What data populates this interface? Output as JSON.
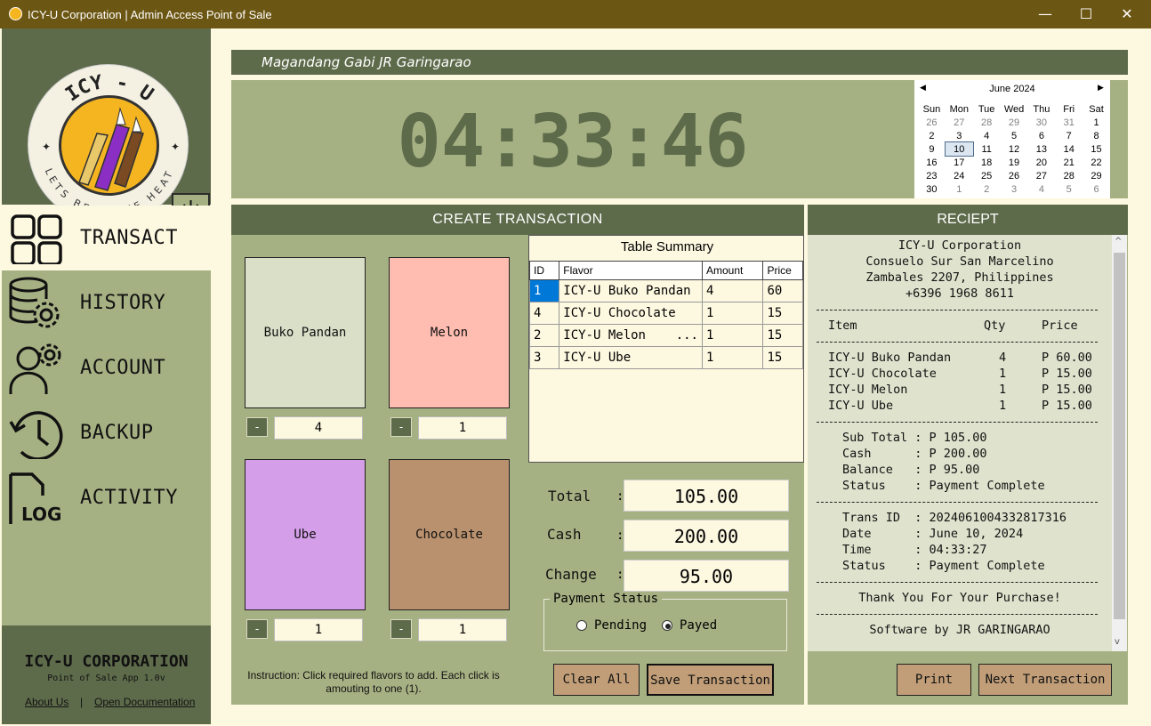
{
  "window": {
    "title": "ICY-U Corporation | Admin Access Point of Sale"
  },
  "logo": {
    "top_text": "ICY - U",
    "tagline": "LETS BEAT THE HEAT"
  },
  "nav": {
    "items": [
      {
        "label": "TRANSACT",
        "icon": "grid-icon"
      },
      {
        "label": "HISTORY",
        "icon": "database-gear-icon"
      },
      {
        "label": "ACCOUNT",
        "icon": "user-gear-icon"
      },
      {
        "label": "BACKUP",
        "icon": "history-clock-icon"
      },
      {
        "label": "ACTIVITY",
        "icon": "log-file-icon"
      }
    ]
  },
  "footer": {
    "company": "ICY-U CORPORATION",
    "version": "Point of Sale App 1.0v",
    "about": "About Us",
    "separator": "|",
    "docs": "Open Documentation"
  },
  "greeting": "Magandang Gabi JR Garingarao",
  "clock": "04:33:46",
  "calendar": {
    "month": "June 2024",
    "days": [
      "Sun",
      "Mon",
      "Tue",
      "Wed",
      "Thu",
      "Fri",
      "Sat"
    ],
    "weeks": [
      [
        "26",
        "27",
        "28",
        "29",
        "30",
        "31",
        "1"
      ],
      [
        "2",
        "3",
        "4",
        "5",
        "6",
        "7",
        "8"
      ],
      [
        "9",
        "10",
        "11",
        "12",
        "13",
        "14",
        "15"
      ],
      [
        "16",
        "17",
        "18",
        "19",
        "20",
        "21",
        "22"
      ],
      [
        "23",
        "24",
        "25",
        "26",
        "27",
        "28",
        "29"
      ],
      [
        "30",
        "1",
        "2",
        "3",
        "4",
        "5",
        "6"
      ]
    ],
    "selected": "10"
  },
  "create": {
    "title": "CREATE TRANSACTION",
    "flavors": [
      {
        "name": "Buko Pandan",
        "qty": "4",
        "color": "#dadfc8"
      },
      {
        "name": "Melon",
        "qty": "1",
        "color": "#ffbcb1"
      },
      {
        "name": "Ube",
        "qty": "1",
        "color": "#d59ee8"
      },
      {
        "name": "Chocolate",
        "qty": "1",
        "color": "#b9916e"
      }
    ],
    "minus_label": "-",
    "instruction": "Instruction: Click required flavors to add. Each click is amouting to one (1)."
  },
  "summary": {
    "title": "Table Summary",
    "columns": [
      "ID",
      "Flavor",
      "Amount",
      "Price"
    ],
    "rows": [
      [
        "1",
        "ICY-U Buko Pandan",
        "4",
        "60"
      ],
      [
        "4",
        "ICY-U Chocolate",
        "1",
        "15"
      ],
      [
        "2",
        "ICY-U Melon    ...",
        "1",
        "15"
      ],
      [
        "3",
        "ICY-U Ube",
        "1",
        "15"
      ]
    ]
  },
  "totals": {
    "total_label": "Total",
    "total": "105.00",
    "cash_label": "Cash",
    "cash": "200.00",
    "change_label": "Change",
    "change": "95.00",
    "colon": ":"
  },
  "payment": {
    "label": "Payment Status",
    "pending": "Pending",
    "payed": "Payed",
    "selected": "Payed"
  },
  "buttons": {
    "clear": "Clear All",
    "save": "Save Transaction",
    "print": "Print",
    "next": "Next Transaction"
  },
  "receipt": {
    "title": "RECIEPT",
    "header": [
      "ICY-U Corporation",
      "Consuelo Sur San Marcelino",
      "Zambales 2207, Philippines",
      "+6396 1968 8611"
    ],
    "col_item": "Item",
    "col_qty": "Qty",
    "col_price": "Price",
    "items": [
      {
        "name": "ICY-U Buko Pandan",
        "qty": "4",
        "price": "P 60.00"
      },
      {
        "name": "ICY-U Chocolate",
        "qty": "1",
        "price": "P 15.00"
      },
      {
        "name": "ICY-U Melon",
        "qty": "1",
        "price": "P 15.00"
      },
      {
        "name": "ICY-U Ube",
        "qty": "1",
        "price": "P 15.00"
      }
    ],
    "summary": [
      "Sub Total : P 105.00",
      "Cash      : P 200.00",
      "Balance   : P 95.00",
      "Status    : Payment Complete"
    ],
    "trans": [
      "Trans ID  : 2024061004332817316",
      "Date      : June 10, 2024",
      "Time      : 04:33:27",
      "Status    : Payment Complete"
    ],
    "thanks": "Thank You For Your Purchase!",
    "credit": "Software by JR GARINGARAO"
  }
}
